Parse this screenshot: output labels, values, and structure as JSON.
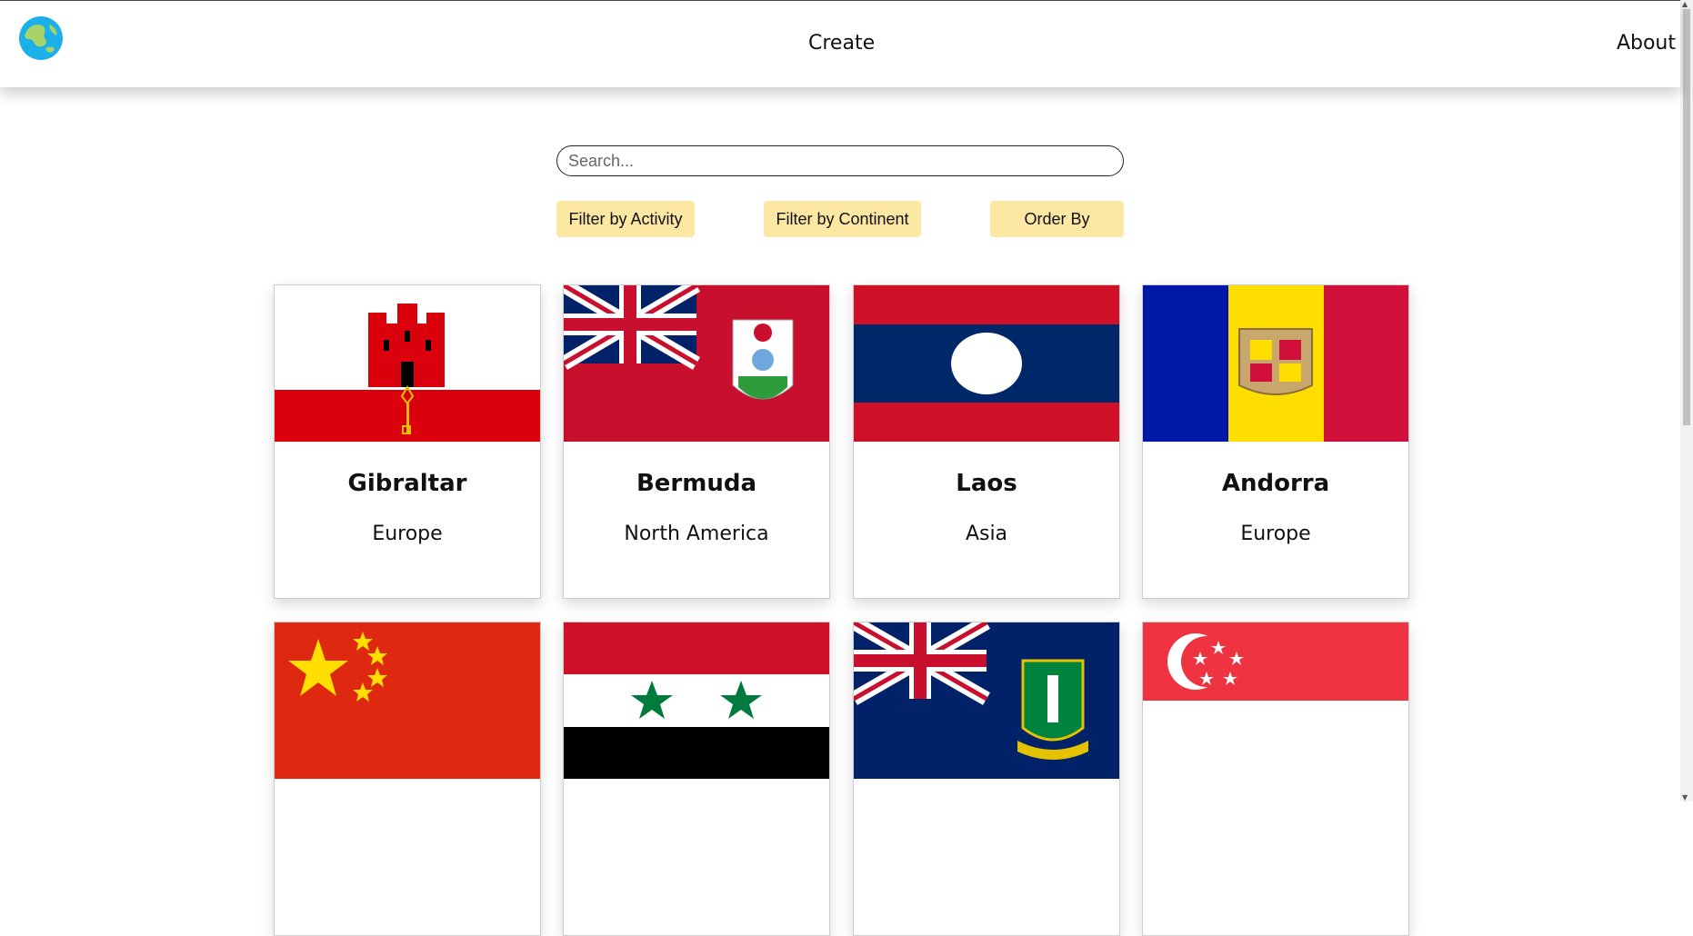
{
  "nav": {
    "logo_icon": "globe-icon",
    "create_label": "Create",
    "about_label": "About"
  },
  "search": {
    "placeholder": "Search..."
  },
  "filters": {
    "activity_label": "Filter by Activity",
    "continent_label": "Filter by Continent",
    "order_label": "Order By"
  },
  "colors": {
    "button_bg": "#fce7a3",
    "navbar_bg": "#ffffff"
  },
  "countries": [
    {
      "name": "Gibraltar",
      "continent": "Europe",
      "flag_icon": "gibraltar-flag-icon"
    },
    {
      "name": "Bermuda",
      "continent": "North America",
      "flag_icon": "bermuda-flag-icon"
    },
    {
      "name": "Laos",
      "continent": "Asia",
      "flag_icon": "laos-flag-icon"
    },
    {
      "name": "Andorra",
      "continent": "Europe",
      "flag_icon": "andorra-flag-icon"
    },
    {
      "name": "",
      "continent": "",
      "flag_icon": "china-flag-icon"
    },
    {
      "name": "",
      "continent": "",
      "flag_icon": "syria-flag-icon"
    },
    {
      "name": "",
      "continent": "",
      "flag_icon": "british-virgin-islands-flag-icon"
    },
    {
      "name": "",
      "continent": "",
      "flag_icon": "singapore-flag-icon"
    }
  ]
}
